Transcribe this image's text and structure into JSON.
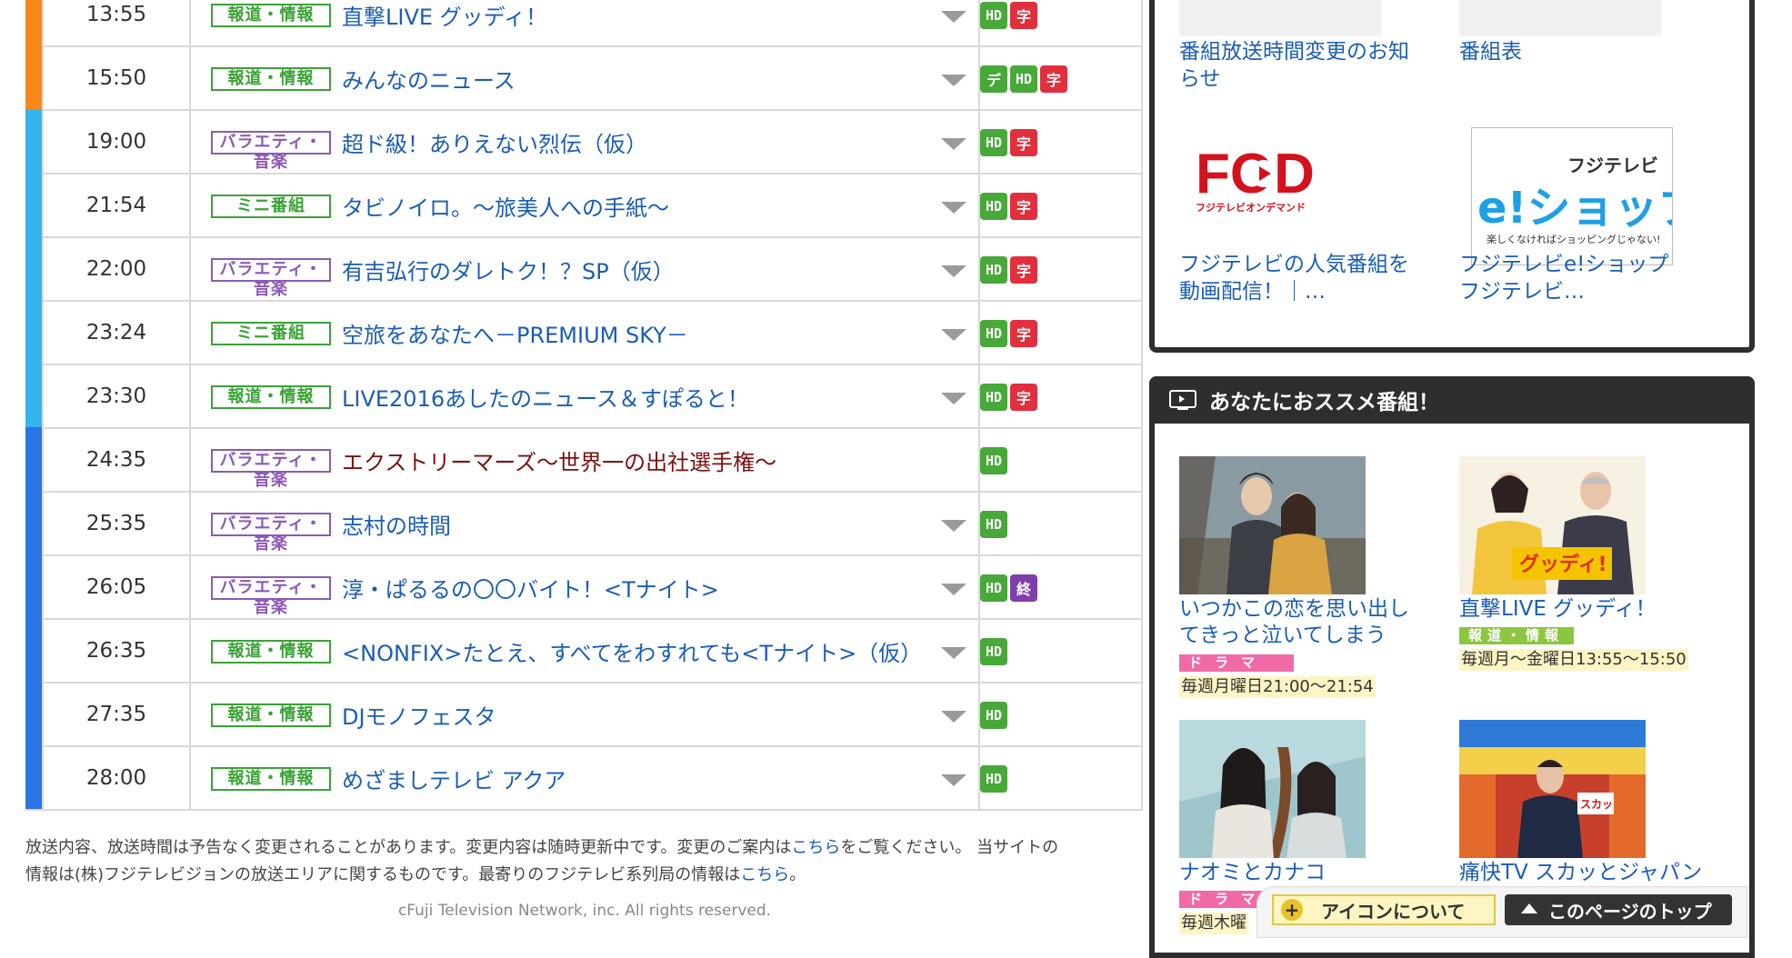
{
  "schedule": [
    {
      "time": "13:55",
      "genre": "報道・情報",
      "genre_class": "green",
      "title": "直撃LIVE グッディ！",
      "badges": [
        "HD",
        "字"
      ],
      "bar": "#f7891b"
    },
    {
      "time": "15:50",
      "genre": "報道・情報",
      "genre_class": "green",
      "title": "みんなのニュース",
      "badges": [
        "デ",
        "HD",
        "字"
      ],
      "bar": "#f7891b"
    },
    {
      "time": "19:00",
      "genre": "バラエティ・音楽",
      "genre_class": "purple",
      "title": "超ド級！ありえない烈伝（仮）",
      "badges": [
        "HD",
        "字"
      ],
      "bar": "#35b5f0"
    },
    {
      "time": "21:54",
      "genre": "ミニ番組",
      "genre_class": "green",
      "title": "タビノイロ。～旅美人への手紙～",
      "badges": [
        "HD",
        "字"
      ],
      "bar": "#35b5f0"
    },
    {
      "time": "22:00",
      "genre": "バラエティ・音楽",
      "genre_class": "purple",
      "title": "有吉弘行のダレトク！？SP（仮）",
      "badges": [
        "HD",
        "字"
      ],
      "bar": "#35b5f0"
    },
    {
      "time": "23:24",
      "genre": "ミニ番組",
      "genre_class": "green",
      "title": "空旅をあなたへ－PREMIUM SKY－",
      "badges": [
        "HD",
        "字"
      ],
      "bar": "#35b5f0"
    },
    {
      "time": "23:30",
      "genre": "報道・情報",
      "genre_class": "green",
      "title": "LIVE2016あしたのニュース＆すぽると！",
      "badges": [
        "HD",
        "字"
      ],
      "bar": "#35b5f0"
    },
    {
      "time": "24:35",
      "genre": "バラエティ・音楽",
      "genre_class": "purple",
      "title": "エクストリーマーズ～世界一の出社選手権～",
      "badges": [
        "HD"
      ],
      "bar": "#2b74e2",
      "dark": true,
      "no_chev": true
    },
    {
      "time": "25:35",
      "genre": "バラエティ・音楽",
      "genre_class": "purple",
      "title": "志村の時間",
      "badges": [
        "HD"
      ],
      "bar": "#2b74e2"
    },
    {
      "time": "26:05",
      "genre": "バラエティ・音楽",
      "genre_class": "purple",
      "title": "淳・ぱるるの〇〇バイト！<Tナイト>",
      "badges": [
        "HD",
        "終"
      ],
      "bar": "#2b74e2"
    },
    {
      "time": "26:35",
      "genre": "報道・情報",
      "genre_class": "green",
      "title": "<NONFIX>たとえ、すべてをわすれても<Tナイト>（仮）",
      "badges": [
        "HD"
      ],
      "bar": "#2b74e2"
    },
    {
      "time": "27:35",
      "genre": "報道・情報",
      "genre_class": "green",
      "title": "DJモノフェスタ",
      "badges": [
        "HD"
      ],
      "bar": "#2b74e2"
    },
    {
      "time": "28:00",
      "genre": "報道・情報",
      "genre_class": "green",
      "title": "めざましテレビ アクア",
      "badges": [
        "HD"
      ],
      "bar": "#2b74e2"
    }
  ],
  "footer": {
    "note_part1": "放送内容、放送時間は予告なく変更されることがあります。変更内容は随時更新中です。変更のご案内は",
    "link1": "こちら",
    "note_part2": "をご覧ください。 当サイトの",
    "note_line2_part1": "情報は(株)フジテレビジョンの放送エリアに関するものです。最寄りのフジテレビ系列局の情報は",
    "link2": "こちら",
    "note_line2_part2": "。",
    "copyright": "cFuji Television Network, inc. All rights reserved."
  },
  "links_panel": {
    "item1": {
      "caption_line1": "番組放送時間変更のお知",
      "caption_line2": "らせ"
    },
    "item2": {
      "caption_line1": "番組表"
    },
    "item3": {
      "logo_text": "FOD",
      "logo_sub": "フジテレビオンデマンド",
      "caption_line1": "フジテレビの人気番組を",
      "caption_line2": "動画配信！｜…"
    },
    "item4": {
      "logo_top": "フジテレビ",
      "logo_main": "e!ショップ",
      "logo_sub": "楽しくなければショッピングじゃない!",
      "caption_line1": "フジテレビe!ショップ",
      "caption_line2": "フジテレビ…"
    }
  },
  "recommend": {
    "heading": "あなたにおススメ番組！",
    "items": [
      {
        "title_line1": "いつかこの恋を思い出し",
        "title_line2": "てきっと泣いてしまう",
        "genre": "ドラマ",
        "genre_color": "#f06aa8",
        "time": "毎週月曜日21:00～21:54"
      },
      {
        "title_line1": "直撃LIVE グッディ！",
        "genre": "報道・情報",
        "genre_color": "#8cc63f",
        "time": "毎週月～金曜日13:55～15:50",
        "logo_text": "グッディ!"
      },
      {
        "title_line1": "ナオミとカナコ",
        "genre": "ドラマ",
        "genre_color": "#f06aa8",
        "time": "毎週木曜"
      },
      {
        "title_line1": "痛快TV スカッとジャパン",
        "sign_text": "スカッ"
      }
    ]
  },
  "floatbar": {
    "about_icons": "アイコンについて",
    "page_top": "このページのトップ"
  }
}
